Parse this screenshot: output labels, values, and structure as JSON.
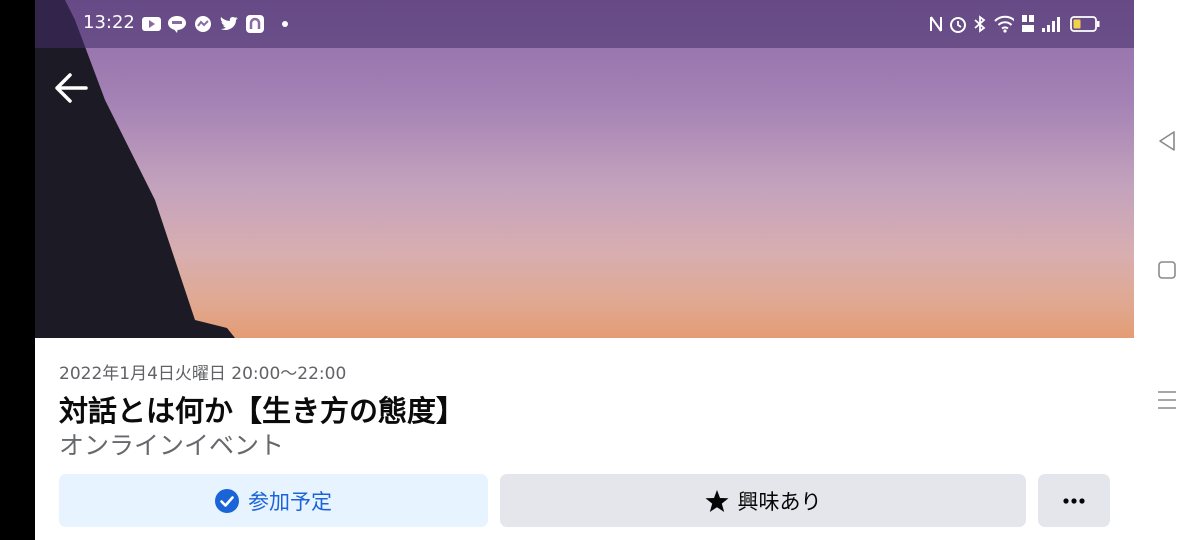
{
  "status_bar": {
    "time": "13:22",
    "left_icons": [
      "youtube-icon",
      "line-icon",
      "messenger-icon",
      "twitter-icon",
      "app-icon",
      "dot-icon"
    ],
    "right_icons": [
      "nfc-icon",
      "alarm-icon",
      "bluetooth-icon",
      "wifi-icon",
      "volte-icon",
      "signal-icon",
      "battery-icon"
    ]
  },
  "event": {
    "date_time": "2022年1月4日火曜日 20:00〜22:00",
    "title": "対話とは何か【生き方の態度】",
    "subtitle": "オンラインイベント"
  },
  "actions": {
    "going_label": "参加予定",
    "interested_label": "興味あり"
  },
  "colors": {
    "accent": "#1a64d8",
    "going_bg": "#e7f3ff",
    "button_bg": "#e4e6eb"
  }
}
